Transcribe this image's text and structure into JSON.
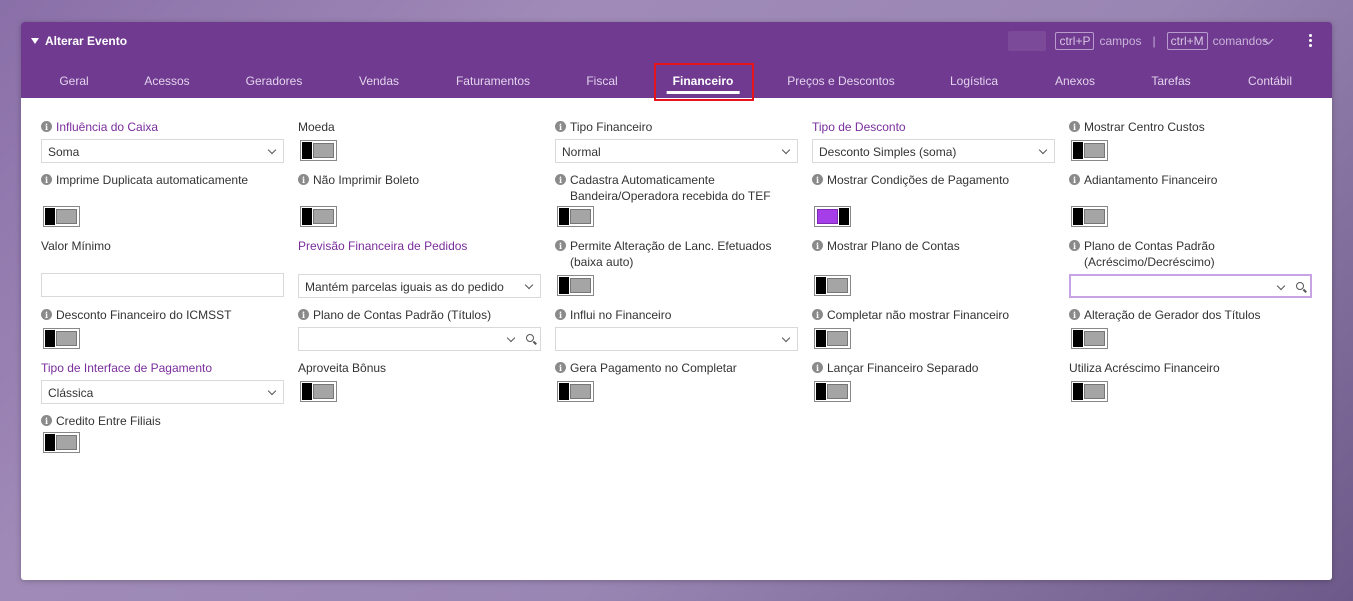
{
  "window": {
    "title": "Alterar Evento"
  },
  "shortcuts": {
    "fields_key": "ctrl+P",
    "fields_label": "campos",
    "commands_key": "ctrl+M",
    "commands_label": "comandos",
    "separator": "|"
  },
  "tabs": [
    {
      "label": "Geral"
    },
    {
      "label": "Acessos"
    },
    {
      "label": "Geradores"
    },
    {
      "label": "Vendas"
    },
    {
      "label": "Faturamentos"
    },
    {
      "label": "Fiscal"
    },
    {
      "label": "Financeiro",
      "active": true
    },
    {
      "label": "Preços e Descontos"
    },
    {
      "label": "Logística"
    },
    {
      "label": "Anexos"
    },
    {
      "label": "Tarefas"
    },
    {
      "label": "Contábil"
    }
  ],
  "fields": {
    "influencia_caixa": {
      "label": "Influência do Caixa",
      "value": "Soma"
    },
    "moeda": {
      "label": "Moeda",
      "state": "off"
    },
    "tipo_financeiro": {
      "label": "Tipo Financeiro",
      "value": "Normal"
    },
    "tipo_desconto": {
      "label": "Tipo de Desconto",
      "value": "Desconto Simples (soma)"
    },
    "mostrar_centro_custos": {
      "label": "Mostrar Centro Custos",
      "state": "off"
    },
    "imprime_duplicata": {
      "label": "Imprime Duplicata automaticamente",
      "state": "off"
    },
    "nao_imprimir_boleto": {
      "label": "Não Imprimir Boleto",
      "state": "off"
    },
    "cadastra_bandeira": {
      "label": "Cadastra Automaticamente Bandeira/Operadora recebida do TEF",
      "state": "off"
    },
    "mostrar_condicoes": {
      "label": "Mostrar Condições de Pagamento",
      "state": "on"
    },
    "adiantamento": {
      "label": "Adiantamento Financeiro",
      "state": "off"
    },
    "valor_minimo": {
      "label": "Valor Mínimo",
      "value": ""
    },
    "previsao_pedidos": {
      "label": "Previsão Financeira de Pedidos",
      "value": "Mantém parcelas iguais as do pedido"
    },
    "permite_alteracao": {
      "label": "Permite Alteração de Lanc. Efetuados (baixa auto)",
      "state": "off"
    },
    "mostrar_plano_contas": {
      "label": "Mostrar Plano de Contas",
      "state": "off"
    },
    "plano_contas_acrescimo": {
      "label": "Plano de Contas Padrão (Acréscimo/Decréscimo)",
      "value": ""
    },
    "desconto_icmsst": {
      "label": "Desconto Financeiro do ICMSST",
      "state": "off"
    },
    "plano_contas_titulos": {
      "label": "Plano de Contas Padrão (Títulos)",
      "value": ""
    },
    "influi_financeiro": {
      "label": "Influi no Financeiro",
      "value": ""
    },
    "completar_nao_mostrar": {
      "label": "Completar não mostrar Financeiro",
      "state": "off"
    },
    "alteracao_gerador": {
      "label": "Alteração de Gerador dos Títulos",
      "state": "off"
    },
    "tipo_interface": {
      "label": "Tipo de Interface de Pagamento",
      "value": "Clássica"
    },
    "aproveita_bonus": {
      "label": "Aproveita Bônus",
      "state": "off"
    },
    "gera_pagamento": {
      "label": "Gera Pagamento no Completar",
      "state": "off"
    },
    "lancar_separado": {
      "label": "Lançar Financeiro Separado",
      "state": "off"
    },
    "utiliza_acrescimo": {
      "label": "Utiliza Acréscimo Financeiro",
      "state": "off"
    },
    "credito_filiais": {
      "label": "Credito Entre Filiais",
      "state": "off"
    }
  },
  "colors": {
    "header": "#6f3a8f",
    "accent": "#a53ee8",
    "highlight": "#e8141c"
  }
}
